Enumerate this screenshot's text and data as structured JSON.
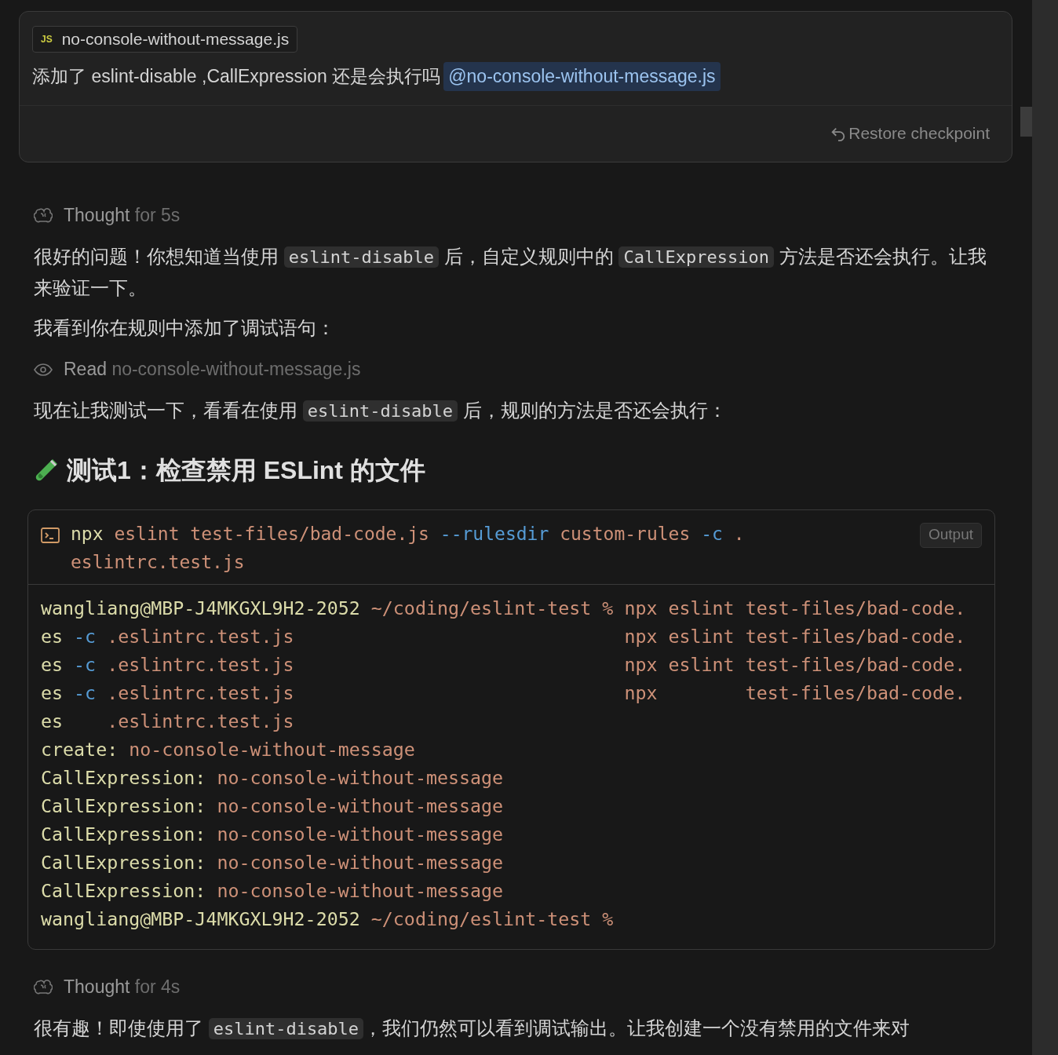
{
  "user_message": {
    "attachment": {
      "badge": "JS",
      "name": "no-console-without-message.js"
    },
    "text": "添加了 eslint-disable ,CallExpression 还是会执行吗",
    "mention": "@no-console-without-message.js",
    "restore": "Restore checkpoint"
  },
  "blocks": [
    {
      "kind": "thought",
      "label": "Thought",
      "detail": "for 5s"
    },
    {
      "kind": "paragraph",
      "segments": [
        {
          "kind": "text",
          "text": "很好的问题！你想知道当使用 "
        },
        {
          "kind": "code",
          "text": "eslint-disable"
        },
        {
          "kind": "text",
          "text": " 后，自定义规则中的 "
        },
        {
          "kind": "code",
          "text": "CallExpression"
        },
        {
          "kind": "text",
          "text": " 方法是否还会执行。让我来验证一下。"
        }
      ]
    },
    {
      "kind": "paragraph",
      "segments": [
        {
          "kind": "text",
          "text": "我看到你在规则中添加了调试语句："
        }
      ]
    },
    {
      "kind": "read",
      "label": "Read",
      "detail": "no-console-without-message.js"
    },
    {
      "kind": "paragraph",
      "segments": [
        {
          "kind": "text",
          "text": "现在让我测试一下，看看在使用 "
        },
        {
          "kind": "code",
          "text": "eslint-disable"
        },
        {
          "kind": "text",
          "text": " 后，规则的方法是否还会执行："
        }
      ]
    },
    {
      "kind": "heading",
      "text": "测试1：检查禁用 ESLint 的文件"
    },
    {
      "kind": "terminal",
      "button": "Output",
      "command": [
        {
          "kind": "cmd",
          "text": "npx"
        },
        {
          "kind": "arg",
          "text": " eslint test-files/bad-code.js "
        },
        {
          "kind": "flag",
          "text": "--rulesdir"
        },
        {
          "kind": "arg",
          "text": " custom-rules "
        },
        {
          "kind": "flag",
          "text": "-c"
        },
        {
          "kind": "arg",
          "text": " .\neslintrc.test.js"
        }
      ],
      "lines": [
        [
          {
            "kind": "cmd",
            "text": "wangliang@MBP-J4MKGXL9H2-2052"
          },
          {
            "kind": "arg",
            "text": " ~/coding/eslint-test % "
          },
          {
            "kind": "arg",
            "text": "npx eslint test-files/bad-code."
          }
        ],
        [
          {
            "kind": "cmd",
            "text": "es "
          },
          {
            "kind": "flag",
            "text": "-c"
          },
          {
            "kind": "arg",
            "text": " .eslintrc.test.js                              npx eslint test-files/bad-code."
          }
        ],
        [
          {
            "kind": "cmd",
            "text": "es "
          },
          {
            "kind": "flag",
            "text": "-c"
          },
          {
            "kind": "arg",
            "text": " .eslintrc.test.js                              npx eslint test-files/bad-code."
          }
        ],
        [
          {
            "kind": "cmd",
            "text": "es "
          },
          {
            "kind": "flag",
            "text": "-c"
          },
          {
            "kind": "arg",
            "text": " .eslintrc.test.js                              npx        test-files/bad-code."
          }
        ],
        [
          {
            "kind": "cmd",
            "text": "es    "
          },
          {
            "kind": "arg",
            "text": ".eslintrc.test.js"
          }
        ],
        [
          {
            "kind": "cmd",
            "text": "create: "
          },
          {
            "kind": "arg",
            "text": "no-console-without-message"
          }
        ],
        [
          {
            "kind": "cmd",
            "text": "CallExpression: "
          },
          {
            "kind": "arg",
            "text": "no-console-without-message"
          }
        ],
        [
          {
            "kind": "cmd",
            "text": "CallExpression: "
          },
          {
            "kind": "arg",
            "text": "no-console-without-message"
          }
        ],
        [
          {
            "kind": "cmd",
            "text": "CallExpression: "
          },
          {
            "kind": "arg",
            "text": "no-console-without-message"
          }
        ],
        [
          {
            "kind": "cmd",
            "text": "CallExpression: "
          },
          {
            "kind": "arg",
            "text": "no-console-without-message"
          }
        ],
        [
          {
            "kind": "cmd",
            "text": "CallExpression: "
          },
          {
            "kind": "arg",
            "text": "no-console-without-message"
          }
        ],
        [
          {
            "kind": "cmd",
            "text": "wangliang@MBP-J4MKGXL9H2-2052"
          },
          {
            "kind": "arg",
            "text": " ~/coding/eslint-test %"
          }
        ]
      ]
    },
    {
      "kind": "thought",
      "label": "Thought",
      "detail": "for 4s"
    },
    {
      "kind": "paragraph",
      "segments": [
        {
          "kind": "text",
          "text": "很有趣！即使使用了 "
        },
        {
          "kind": "code",
          "text": "eslint-disable"
        },
        {
          "kind": "text",
          "text": "，我们仍然可以看到调试输出。让我创建一个没有禁用的文件来对"
        }
      ]
    }
  ]
}
